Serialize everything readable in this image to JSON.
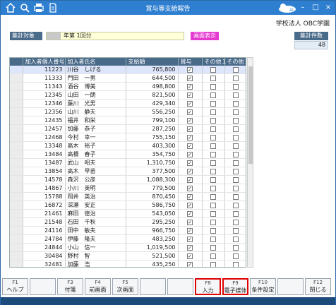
{
  "window": {
    "title": "賞与等支給報告",
    "corp_name": "学校法人 OBC学園"
  },
  "filter": {
    "target_label": "集計対象",
    "target_value": "年第 1回分",
    "display_button": "画面表示"
  },
  "count": {
    "label": "集計件数",
    "value": "48"
  },
  "table": {
    "headers": [
      "加入者個人番号",
      "加入者氏名",
      "支給額",
      "賞与",
      "その他１",
      "その他２"
    ],
    "rows": [
      {
        "no": "11223",
        "name": "川谷　しげる",
        "amount": "765,800",
        "bonus": true,
        "o1": false,
        "o2": false
      },
      {
        "no": "11333",
        "name": "門田　一男",
        "amount": "644,500",
        "bonus": true,
        "o1": false,
        "o2": false
      },
      {
        "no": "11343",
        "name": "酒谷　博美",
        "amount": "498,800",
        "bonus": true,
        "o1": false,
        "o2": false
      },
      {
        "no": "12345",
        "name": "山田　一朗",
        "amount": "821,500",
        "bonus": true,
        "o1": false,
        "o2": false
      },
      {
        "no": "12346",
        "name": "藤川　光男",
        "amount": "429,340",
        "bonus": true,
        "o1": false,
        "o2": false
      },
      {
        "no": "12356",
        "name": "山川　静夫",
        "amount": "556,250",
        "bonus": true,
        "o1": false,
        "o2": false
      },
      {
        "no": "12435",
        "name": "福井　和栄",
        "amount": "799,100",
        "bonus": true,
        "o1": false,
        "o2": false
      },
      {
        "no": "12457",
        "name": "加藤　恭子",
        "amount": "287,250",
        "bonus": true,
        "o1": false,
        "o2": false
      },
      {
        "no": "12468",
        "name": "今村　幸一",
        "amount": "755,150",
        "bonus": true,
        "o1": false,
        "o2": false
      },
      {
        "no": "13348",
        "name": "高木　裕子",
        "amount": "403,300",
        "bonus": true,
        "o1": false,
        "o2": false
      },
      {
        "no": "13484",
        "name": "高橋　春子",
        "amount": "354,750",
        "bonus": true,
        "o1": false,
        "o2": false
      },
      {
        "no": "13487",
        "name": "武山　昭夫",
        "amount": "1,310,750",
        "bonus": true,
        "o1": false,
        "o2": false
      },
      {
        "no": "13854",
        "name": "高木　早苗",
        "amount": "377,500",
        "bonus": true,
        "o1": false,
        "o2": false
      },
      {
        "no": "14578",
        "name": "森沢　公彦",
        "amount": "1,088,300",
        "bonus": true,
        "o1": false,
        "o2": false
      },
      {
        "no": "14867",
        "name": "小川　英明",
        "amount": "779,500",
        "bonus": true,
        "o1": false,
        "o2": false
      },
      {
        "no": "15788",
        "name": "岡井　英治",
        "amount": "870,450",
        "bonus": true,
        "o1": false,
        "o2": false
      },
      {
        "no": "16872",
        "name": "深瀬　安正",
        "amount": "586,750",
        "bonus": true,
        "o1": false,
        "o2": false
      },
      {
        "no": "21461",
        "name": "麻田　徳治",
        "amount": "543,050",
        "bonus": true,
        "o1": false,
        "o2": false
      },
      {
        "no": "21548",
        "name": "石田　千秋",
        "amount": "295,250",
        "bonus": true,
        "o1": false,
        "o2": false
      },
      {
        "no": "24116",
        "name": "田中　敏夫",
        "amount": "966,750",
        "bonus": true,
        "o1": false,
        "o2": false
      },
      {
        "no": "24784",
        "name": "伊藤　隆夫",
        "amount": "483,250",
        "bonus": true,
        "o1": false,
        "o2": false
      },
      {
        "no": "24844",
        "name": "小山　信一",
        "amount": "1,019,500",
        "bonus": true,
        "o1": false,
        "o2": false
      },
      {
        "no": "30484",
        "name": "野村　智",
        "amount": "521,500",
        "bonus": true,
        "o1": false,
        "o2": false
      },
      {
        "no": "32481",
        "name": "加藤　浩",
        "amount": "435,250",
        "bonus": true,
        "o1": false,
        "o2": false
      },
      {
        "no": "32511",
        "name": "福岡　明夫",
        "amount": "640,350",
        "bonus": true,
        "o1": false,
        "o2": false
      },
      {
        "no": "33449",
        "name": "中野　浩一",
        "amount": "905,300",
        "bonus": true,
        "o1": false,
        "o2": false
      }
    ]
  },
  "fkeys": [
    {
      "key": "F1",
      "label": "ヘルプ"
    },
    {
      "key": "",
      "label": ""
    },
    {
      "key": "F3",
      "label": "付箋"
    },
    {
      "key": "F4",
      "label": "前画面"
    },
    {
      "key": "F5",
      "label": "次画面"
    },
    {
      "key": "",
      "label": ""
    },
    {
      "key": "",
      "label": ""
    },
    {
      "key": "F8",
      "label": "入力"
    },
    {
      "key": "F9",
      "label": "電子媒体"
    },
    {
      "key": "F10",
      "label": "条件設定"
    },
    {
      "key": "",
      "label": ""
    },
    {
      "key": "F12",
      "label": "閉じる"
    }
  ],
  "icons": {
    "toolbar": [
      "home-icon",
      "search-icon",
      "print-icon",
      "document-icon"
    ],
    "check": "checkmark-icon"
  },
  "colors": {
    "titlebar": "#2f7fd0",
    "header": "#4a6a8a",
    "highlight": "#e00000",
    "display_button": "#e53ad0"
  }
}
